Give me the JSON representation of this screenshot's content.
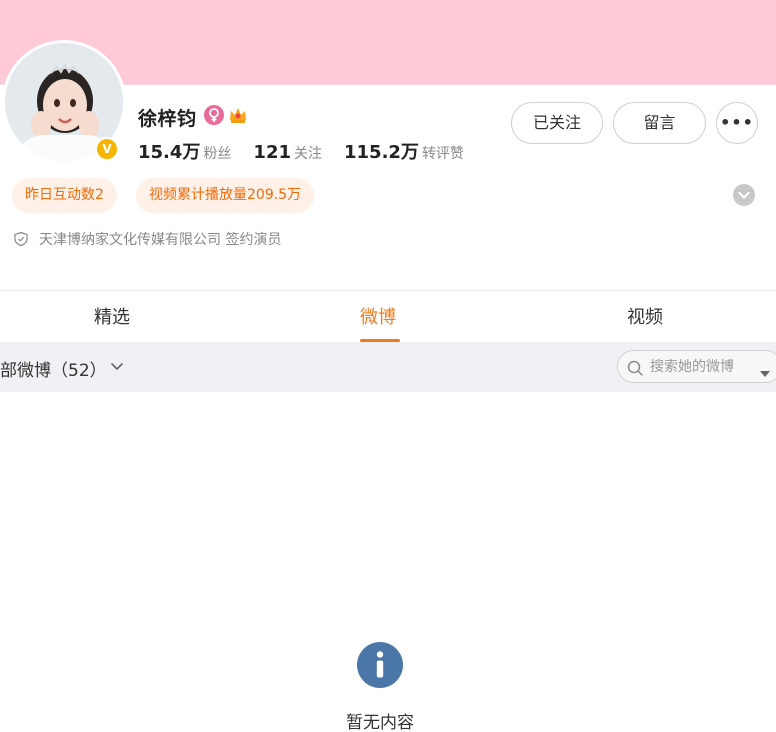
{
  "profile": {
    "name": "徐梓钧",
    "stats": [
      {
        "value": "15.4万",
        "label": "粉丝"
      },
      {
        "value": "121",
        "label": "关注"
      },
      {
        "value": "115.2万",
        "label": "转评赞"
      }
    ],
    "buttons": {
      "follow": "已关注",
      "message": "留言",
      "more": "•••"
    },
    "tags": [
      "昨日互动数2",
      "视频累计播放量209.5万"
    ],
    "company": "天津博纳家文化传媒有限公司 签约演员"
  },
  "tabs": [
    {
      "label": "精选",
      "active": false
    },
    {
      "label": "微博",
      "active": true
    },
    {
      "label": "视频",
      "active": false
    }
  ],
  "filter": {
    "label": "部微博（52）",
    "search_placeholder": "搜索她的微博"
  },
  "empty_state": {
    "text": "暂无内容"
  },
  "colors": {
    "banner": "#ffcad7",
    "accent": "#f27b1b",
    "tag_bg": "#fff1e7",
    "tag_text": "#f26a0b",
    "info_icon": "#4a76a8"
  },
  "icons": [
    "verified-icon",
    "female-icon",
    "crown-icon",
    "expand-icon",
    "shield-icon",
    "chevron-down-icon",
    "search-icon",
    "dropdown-caret-icon",
    "info-icon"
  ]
}
